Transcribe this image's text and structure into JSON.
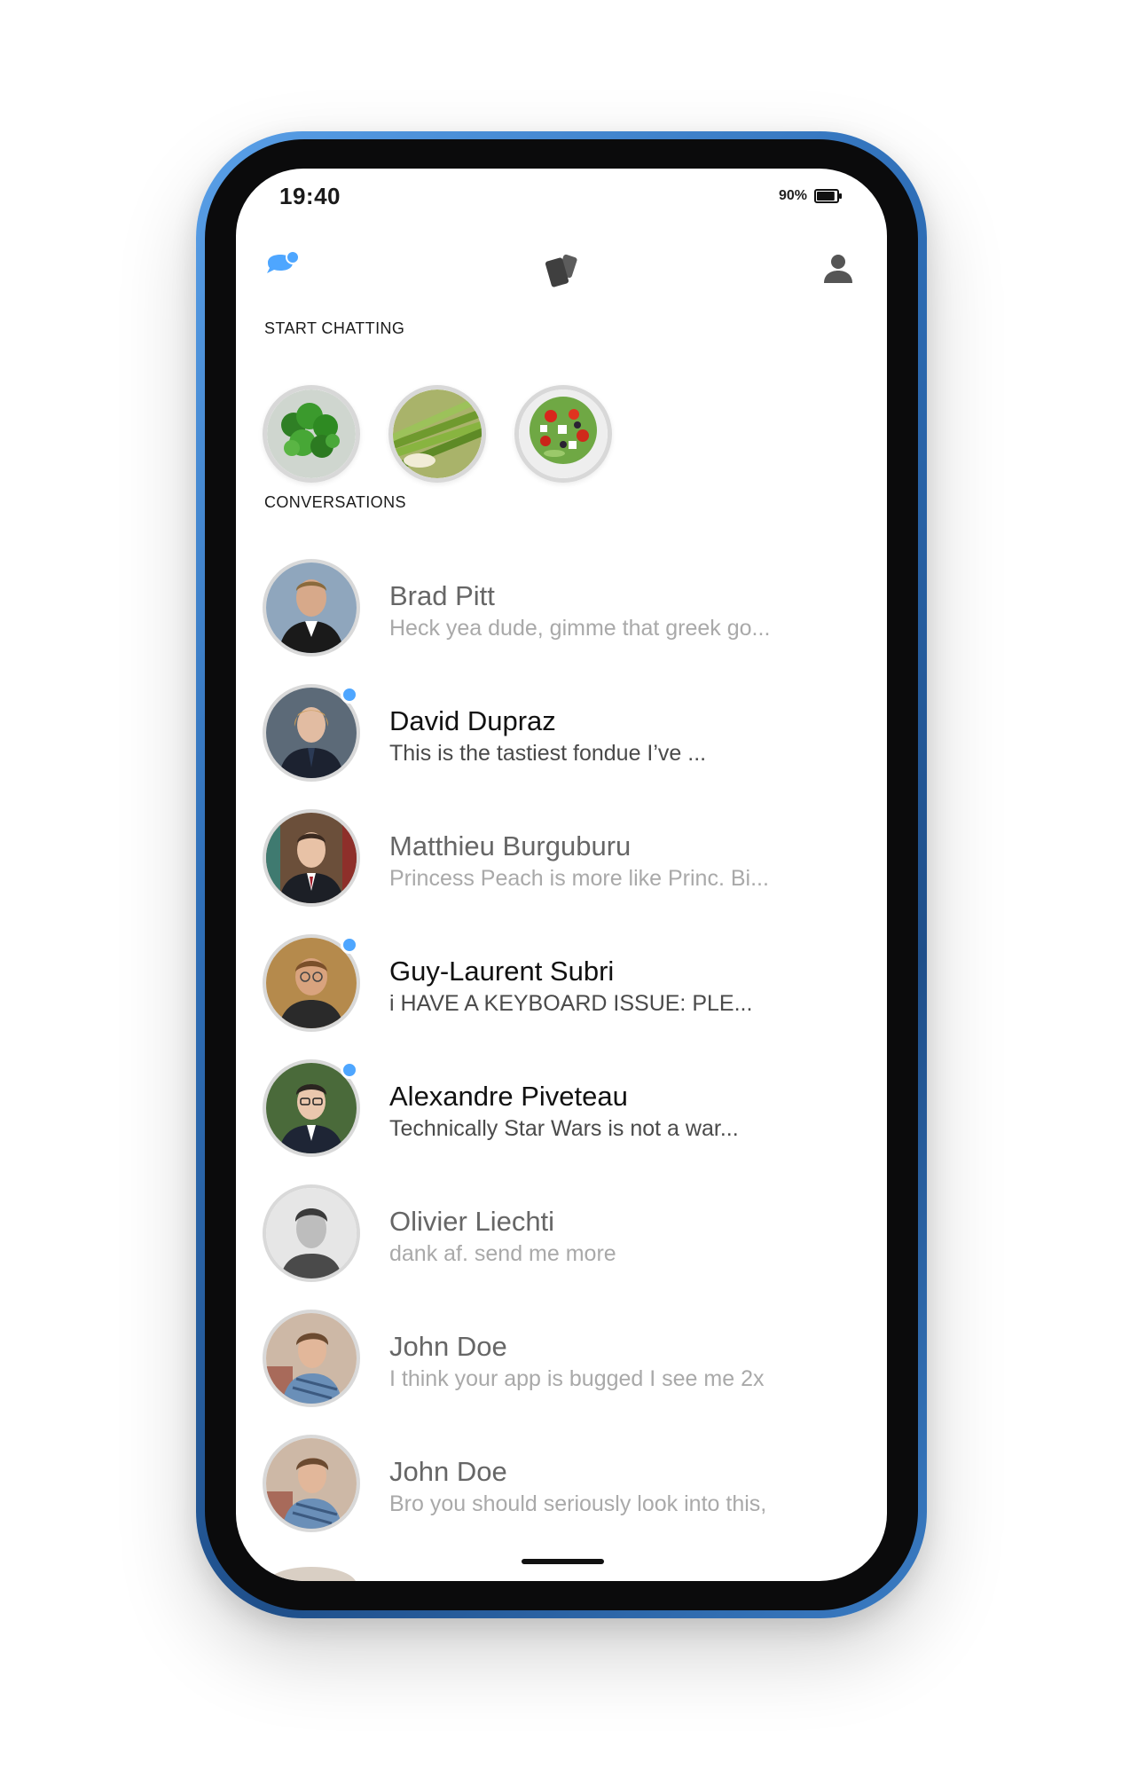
{
  "status_bar": {
    "time": "19:40",
    "battery_percent": "90%",
    "battery_level": 0.9
  },
  "nav": {
    "chat_icon": "chat-bubbles-icon",
    "cards_icon": "cards-icon",
    "profile_icon": "user-icon",
    "accent_color": "#4ea6ff"
  },
  "start_chatting": {
    "title": "START CHATTING",
    "items": [
      {
        "image": "broccoli"
      },
      {
        "image": "asparagus"
      },
      {
        "image": "greek-salad"
      }
    ]
  },
  "conversations": {
    "title": "CONVERSATIONS",
    "items": [
      {
        "name": "Brad Pitt",
        "preview": "Heck yea dude, gimme that greek go...",
        "unread": false
      },
      {
        "name": "David Dupraz",
        "preview": "This is the tastiest fondue I’ve ...",
        "unread": true
      },
      {
        "name": "Matthieu Burguburu",
        "preview": "Princess Peach is more like Princ. Bi...",
        "unread": false
      },
      {
        "name": "Guy-Laurent Subri",
        "preview": "i HAVE A KEYBOARD ISSUE: PLE...",
        "unread": true
      },
      {
        "name": "Alexandre Piveteau",
        "preview": "Technically Star Wars is not a war...",
        "unread": true
      },
      {
        "name": "Olivier Liechti",
        "preview": "dank af. send me more",
        "unread": false
      },
      {
        "name": "John Doe",
        "preview": "I think your app is bugged I see me 2x",
        "unread": false
      },
      {
        "name": "John Doe",
        "preview": "Bro you should seriously look into this,",
        "unread": false
      }
    ]
  }
}
